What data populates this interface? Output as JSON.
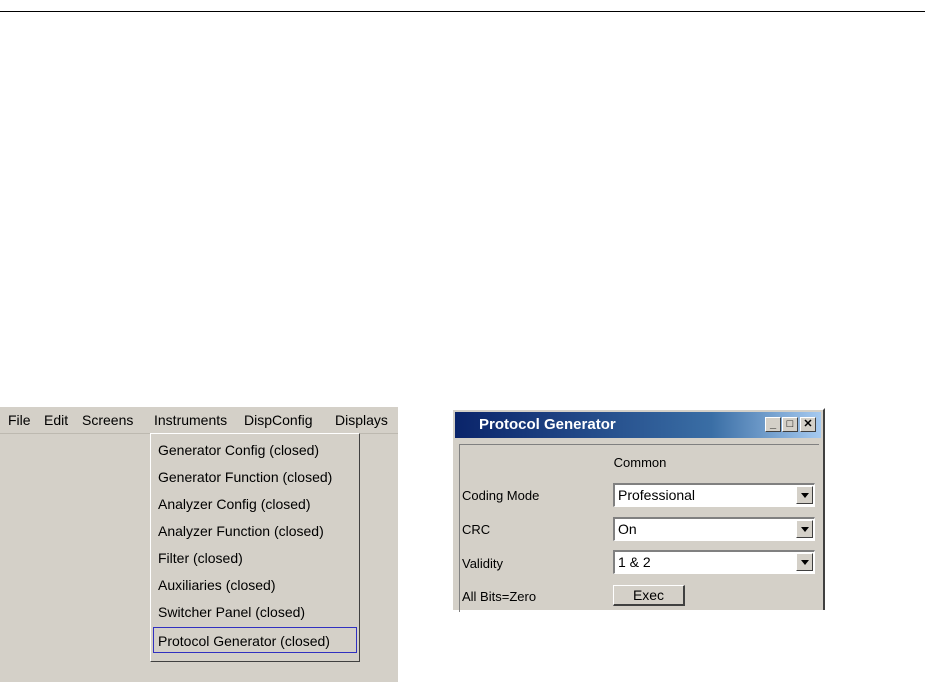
{
  "menubar": {
    "items": [
      "File",
      "Edit",
      "Screens",
      "Instruments",
      "DispConfig",
      "Displays"
    ]
  },
  "instruments_menu": {
    "items": [
      "Generator Config (closed)",
      "Generator Function (closed)",
      "Analyzer Config (closed)",
      "Analyzer Function (closed)",
      "Filter (closed)",
      "Auxiliaries (closed)",
      "Switcher Panel (closed)",
      "Protocol Generator (closed)"
    ],
    "selected": "Protocol Generator (closed)"
  },
  "protocol_window": {
    "title": "Protocol Generator",
    "section": "Common",
    "rows": [
      {
        "label": "Coding Mode",
        "value": "Professional"
      },
      {
        "label": "CRC",
        "value": "On"
      },
      {
        "label": "Validity",
        "value": "1 & 2"
      }
    ],
    "all_bits": {
      "label": "All Bits=Zero",
      "button": "Exec"
    },
    "controls": {
      "minimize": "_",
      "maximize": "□",
      "close": "✕"
    }
  }
}
